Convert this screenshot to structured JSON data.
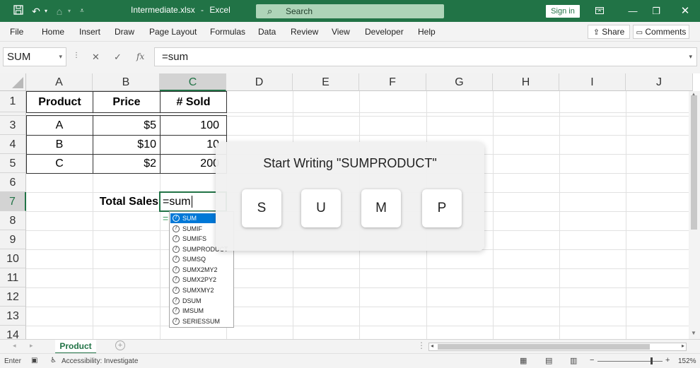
{
  "titlebar": {
    "filename": "Intermediate.xlsx",
    "separator": "-",
    "app": "Excel",
    "search_placeholder": "Search",
    "signin_label": "Sign in"
  },
  "menu": [
    "File",
    "Home",
    "Insert",
    "Draw",
    "Page Layout",
    "Formulas",
    "Data",
    "Review",
    "View",
    "Developer",
    "Help"
  ],
  "share_label": "Share",
  "comments_label": "Comments",
  "formula_bar": {
    "name_box": "SUM",
    "formula": "=sum"
  },
  "columns": [
    "A",
    "B",
    "C",
    "D",
    "E",
    "F",
    "G",
    "H",
    "I",
    "J"
  ],
  "rows": [
    "1",
    "3",
    "4",
    "5",
    "6",
    "7",
    "8",
    "9",
    "10",
    "11",
    "12",
    "13",
    "14"
  ],
  "table": {
    "headers": [
      "Product",
      "Price",
      "# Sold"
    ],
    "rows": [
      [
        "A",
        "$5",
        "100"
      ],
      [
        "B",
        "$10",
        "10"
      ],
      [
        "C",
        "$2",
        "200"
      ]
    ],
    "total_label": "Total Sales",
    "editing_value": "=sum",
    "ghost_formula": "="
  },
  "autocomplete": [
    "SUM",
    "SUMIF",
    "SUMIFS",
    "SUMPRODUCT",
    "SUMSQ",
    "SUMX2MY2",
    "SUMX2PY2",
    "SUMXMY2",
    "DSUM",
    "IMSUM",
    "SERIESSUM"
  ],
  "overlay": {
    "title": "Start Writing \"SUMPRODUCT\"",
    "keys": [
      "S",
      "U",
      "M",
      "P"
    ]
  },
  "sheet_tab": "Product",
  "status": {
    "mode": "Enter",
    "accessibility": "Accessibility: Investigate",
    "zoom": "152%"
  },
  "colors": {
    "excel_green": "#217346",
    "selection_blue": "#0078d7"
  }
}
